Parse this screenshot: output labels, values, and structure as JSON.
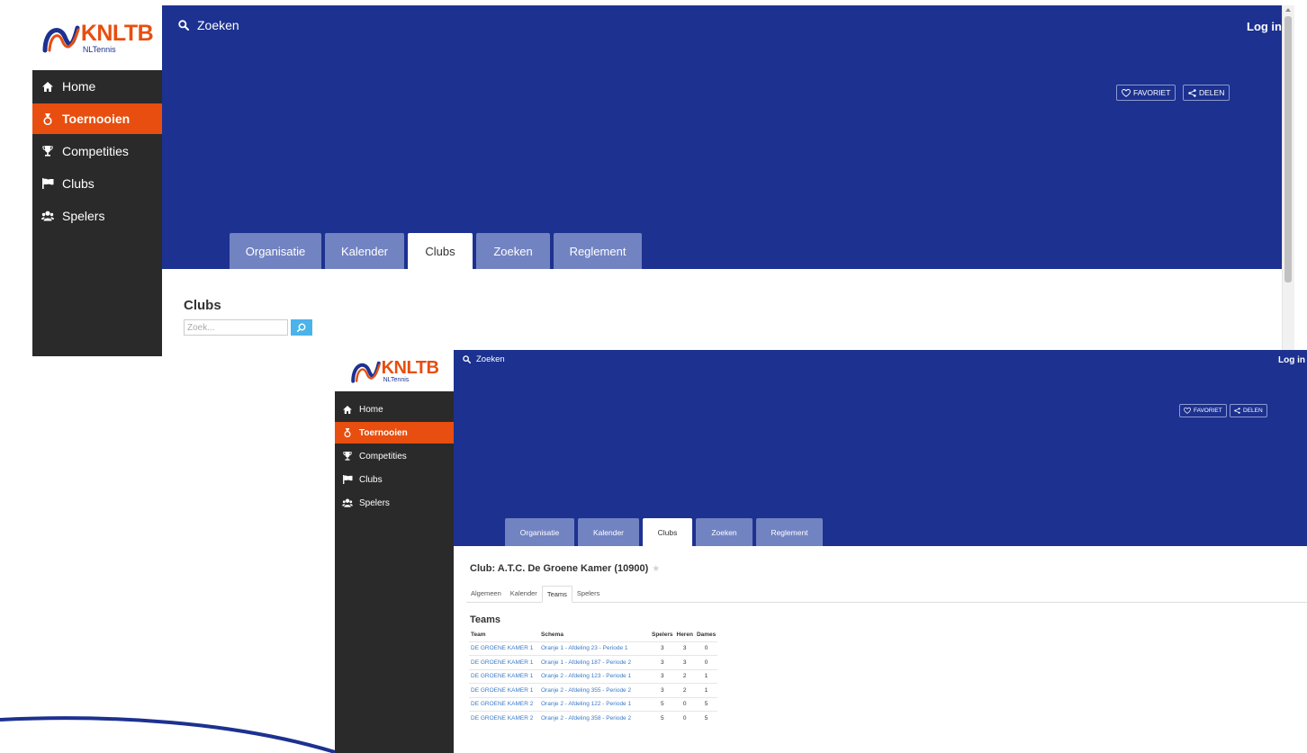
{
  "brand": {
    "name": "KNLTB",
    "subtitle": "NLTennis",
    "colors": {
      "orange": "#e84e0f",
      "navy": "#1c3190",
      "sidebar": "#2a2a2a",
      "tab": "#7283c2",
      "link": "#3a7bc8",
      "search_button": "#4ab3ea"
    }
  },
  "sidebar": {
    "items": [
      {
        "label": "Home",
        "icon": "home-icon"
      },
      {
        "label": "Toernooien",
        "icon": "medal-icon",
        "active": true
      },
      {
        "label": "Competities",
        "icon": "trophy-icon"
      },
      {
        "label": "Clubs",
        "icon": "flag-icon"
      },
      {
        "label": "Spelers",
        "icon": "users-icon"
      }
    ]
  },
  "header": {
    "search_label": "Zoeken",
    "login_label": "Log in",
    "favoriet_label": "FAVORIET",
    "delen_label": "DELEN"
  },
  "tabs": [
    {
      "label": "Organisatie"
    },
    {
      "label": "Kalender"
    },
    {
      "label": "Clubs",
      "active": true
    },
    {
      "label": "Zoeken"
    },
    {
      "label": "Reglement"
    }
  ],
  "clubs_page": {
    "title": "Clubs",
    "search_placeholder": "Zoek..."
  },
  "club_page": {
    "title": "Club: A.T.C. De Groene Kamer (10900)",
    "subtabs": [
      {
        "label": "Algemeen"
      },
      {
        "label": "Kalender"
      },
      {
        "label": "Teams",
        "active": true
      },
      {
        "label": "Spelers"
      }
    ],
    "teams_title": "Teams",
    "table": {
      "headers": [
        "Team",
        "Schema",
        "Spelers",
        "Heren",
        "Dames"
      ],
      "rows": [
        [
          "DE GROENE KAMER 1",
          "Oranje 1 - Afdeling 23 - Periode 1",
          "3",
          "3",
          "0"
        ],
        [
          "DE GROENE KAMER 1",
          "Oranje 1 - Afdeling 187 - Periode 2",
          "3",
          "3",
          "0"
        ],
        [
          "DE GROENE KAMER 1",
          "Oranje 2 - Afdeling 123 - Periode 1",
          "3",
          "2",
          "1"
        ],
        [
          "DE GROENE KAMER 1",
          "Oranje 2 - Afdeling 355 - Periode 2",
          "3",
          "2",
          "1"
        ],
        [
          "DE GROENE KAMER 2",
          "Oranje 2 - Afdeling 122 - Periode 1",
          "5",
          "0",
          "5"
        ],
        [
          "DE GROENE KAMER 2",
          "Oranje 2 - Afdeling 358 - Periode 2",
          "5",
          "0",
          "5"
        ]
      ]
    }
  }
}
